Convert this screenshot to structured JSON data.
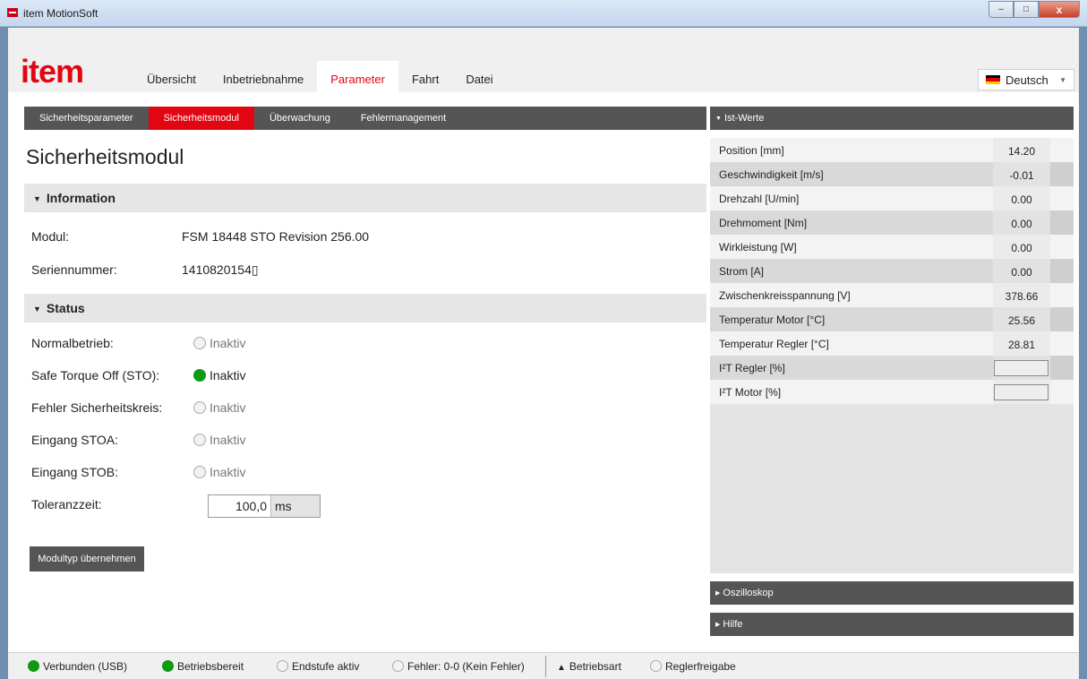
{
  "window": {
    "title": "item MotionSoft",
    "minimize": "–",
    "maximize": "□",
    "close": "x"
  },
  "header": {
    "logo": "item",
    "tabs": [
      {
        "label": "Übersicht"
      },
      {
        "label": "Inbetriebnahme"
      },
      {
        "label": "Parameter",
        "active": true
      },
      {
        "label": "Fahrt"
      },
      {
        "label": "Datei"
      }
    ],
    "language": {
      "selected": "Deutsch",
      "flag_colors": [
        "#000000",
        "#dd0000",
        "#ffce00"
      ]
    }
  },
  "subtabs": [
    {
      "label": "Sicherheitsparameter"
    },
    {
      "label": "Sicherheitsmodul",
      "active": true
    },
    {
      "label": "Überwachung"
    },
    {
      "label": "Fehlermanagement"
    }
  ],
  "page": {
    "title": "Sicherheitsmodul"
  },
  "information": {
    "heading": "Information",
    "modul_label": "Modul:",
    "modul_value": "FSM 18448 STO Revision 256.00",
    "serial_label": "Seriennummer:",
    "serial_value": "1410820154▯"
  },
  "status": {
    "heading": "Status",
    "rows": [
      {
        "label": "Normalbetrieb:",
        "state": "Inaktiv",
        "active": false
      },
      {
        "label": "Safe Torque Off (STO):",
        "state": "Inaktiv",
        "active": true
      },
      {
        "label": "Fehler Sicherheitskreis:",
        "state": "Inaktiv",
        "active": false
      },
      {
        "label": "Eingang STOA:",
        "state": "Inaktiv",
        "active": false
      },
      {
        "label": "Eingang STOB:",
        "state": "Inaktiv",
        "active": false
      }
    ],
    "tolerance_label": "Toleranzzeit:",
    "tolerance_value": "100,0",
    "tolerance_unit": "ms"
  },
  "buttons": {
    "apply_module": "Modultyp übernehmen"
  },
  "ist_werte": {
    "heading": "Ist-Werte",
    "rows": [
      {
        "label": "Position [mm]",
        "value": "14.20"
      },
      {
        "label": "Geschwindigkeit [m/s]",
        "value": "-0.01"
      },
      {
        "label": "Drehzahl [U/min]",
        "value": "0.00"
      },
      {
        "label": "Drehmoment [Nm]",
        "value": "0.00"
      },
      {
        "label": "Wirkleistung [W]",
        "value": "0.00"
      },
      {
        "label": "Strom [A]",
        "value": "0.00"
      },
      {
        "label": "Zwischenkreisspannung [V]",
        "value": "378.66"
      },
      {
        "label": "Temperatur Motor  [°C]",
        "value": "25.56"
      },
      {
        "label": "Temperatur Regler  [°C]",
        "value": "28.81"
      },
      {
        "label": "I²T Regler  [%]",
        "value": "",
        "bar": true
      },
      {
        "label": "I²T Motor  [%]",
        "value": "",
        "bar": true
      }
    ]
  },
  "panels": {
    "oszilloskop": "Oszilloskop",
    "hilfe": "Hilfe"
  },
  "statusbar": {
    "items": [
      {
        "label": "Verbunden (USB)",
        "active": true
      },
      {
        "label": "Betriebsbereit",
        "active": true
      },
      {
        "label": "Endstufe aktiv",
        "active": false
      },
      {
        "label": "Fehler: 0-0 (Kein Fehler)",
        "active": false
      },
      {
        "label": "Betriebsart",
        "triangle": true
      },
      {
        "label": "Reglerfreigabe",
        "active": false
      }
    ]
  }
}
